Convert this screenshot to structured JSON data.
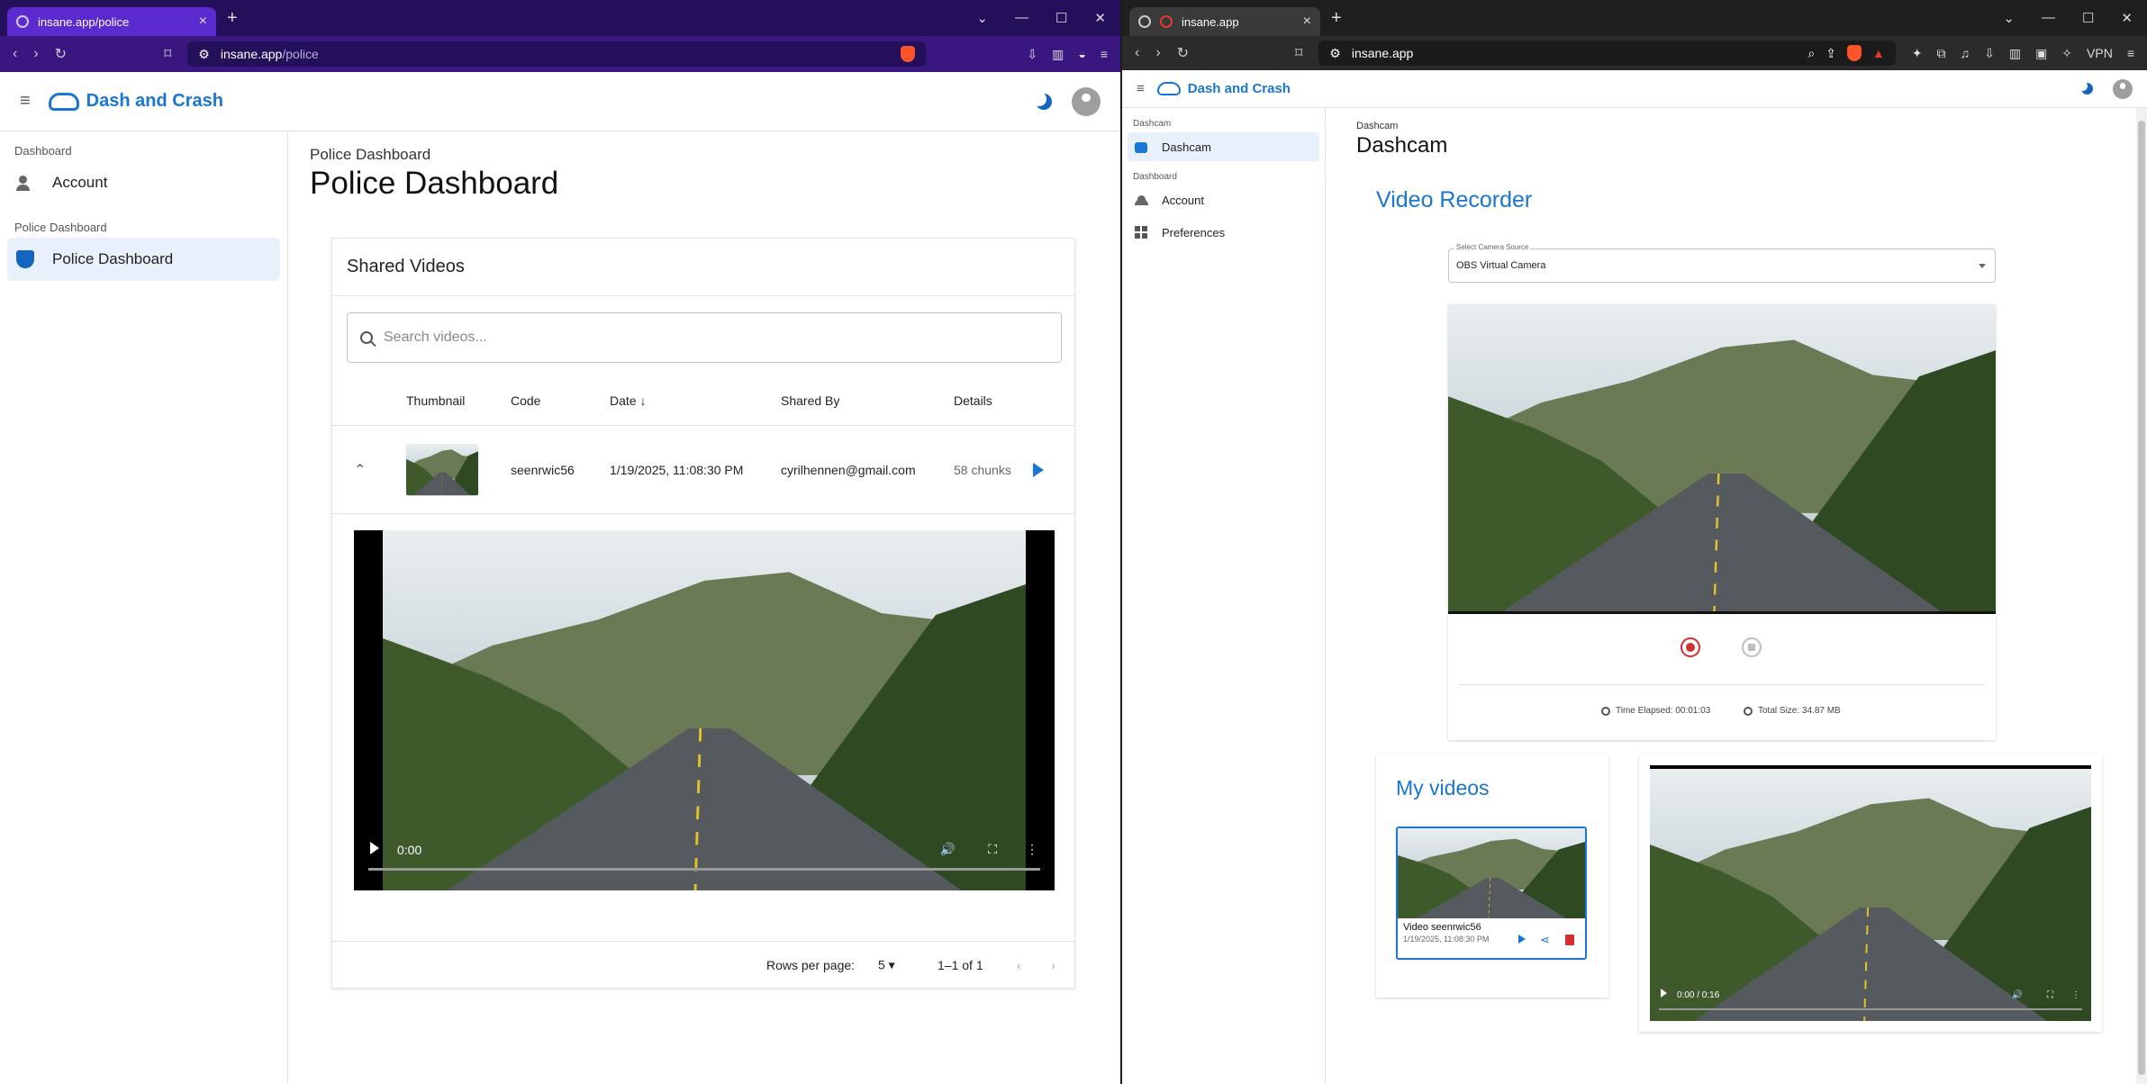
{
  "left": {
    "tab_title": "insane.app/police",
    "url_host": "insane.app",
    "url_path": "/police",
    "brand": "Dash and Crash",
    "sidebar": {
      "sections": [
        {
          "header": "Dashboard",
          "items": [
            {
              "label": "Account",
              "icon": "account-gear-icon"
            }
          ]
        },
        {
          "header": "Police Dashboard",
          "items": [
            {
              "label": "Police Dashboard",
              "icon": "shield-icon",
              "active": true
            }
          ]
        }
      ]
    },
    "breadcrumb": "Police Dashboard",
    "page_title": "Police Dashboard",
    "card_title": "Shared Videos",
    "search_placeholder": "Search videos...",
    "columns": {
      "thumbnail": "Thumbnail",
      "code": "Code",
      "date": "Date",
      "shared_by": "Shared By",
      "details": "Details"
    },
    "row": {
      "code": "seenrwic56",
      "date": "1/19/2025, 11:08:30 PM",
      "shared_by": "cyrilhennen@gmail.com",
      "details": "58 chunks"
    },
    "video_time": "0:00",
    "rows_per_page_label": "Rows per page:",
    "rows_per_page": "5",
    "page_range": "1–1 of 1"
  },
  "right": {
    "tab_title": "insane.app",
    "url": "insane.app",
    "vpn": "VPN",
    "brand": "Dash and Crash",
    "sidebar": {
      "section1": "Dashcam",
      "item_dashcam": "Dashcam",
      "section2": "Dashboard",
      "item_account": "Account",
      "item_prefs": "Preferences"
    },
    "breadcrumb": "Dashcam",
    "page_title": "Dashcam",
    "recorder_title": "Video Recorder",
    "camera_label": "Select Camera Source",
    "camera_value": "OBS Virtual Camera",
    "time_elapsed": "Time Elapsed: 00:01:03",
    "total_size": "Total Size: 34.87 MB",
    "my_videos_title": "My videos",
    "video_name": "Video seenrwic56",
    "video_date": "1/19/2025, 11:08:30 PM",
    "player_time": "0:00 / 0:16"
  },
  "colors": {
    "brand_blue": "#1976d2",
    "record_red": "#d32f2f",
    "left_browser": "#3a1680"
  }
}
